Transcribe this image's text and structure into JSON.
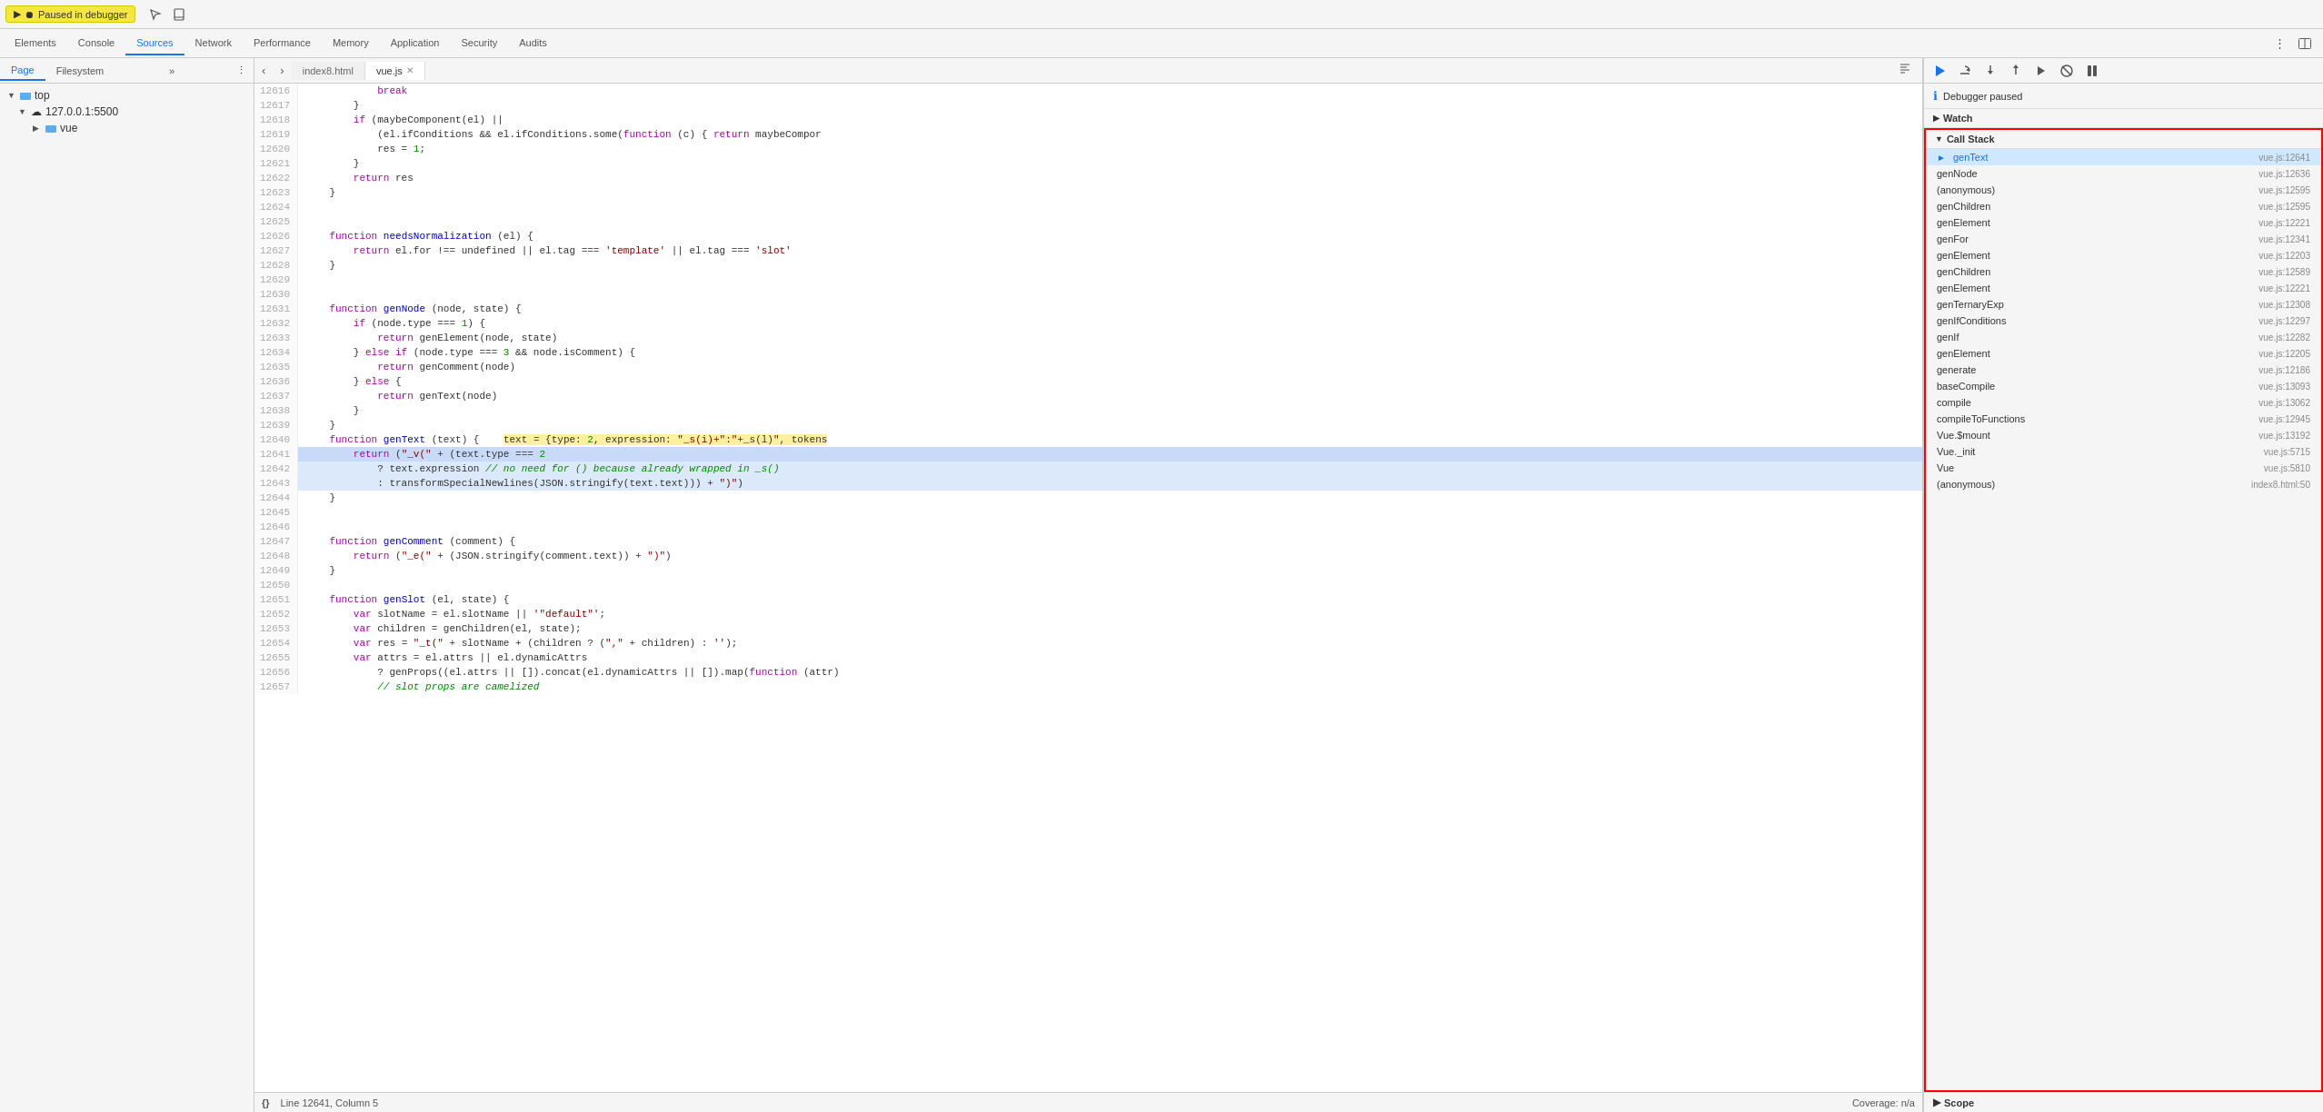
{
  "topbar": {
    "paused_label": "Paused in debugger",
    "icons": [
      "resume",
      "step-over",
      "step-into",
      "step-out",
      "deactivate"
    ]
  },
  "tabs": {
    "items": [
      {
        "label": "Elements",
        "active": false
      },
      {
        "label": "Console",
        "active": false
      },
      {
        "label": "Sources",
        "active": true
      },
      {
        "label": "Network",
        "active": false
      },
      {
        "label": "Performance",
        "active": false
      },
      {
        "label": "Memory",
        "active": false
      },
      {
        "label": "Application",
        "active": false
      },
      {
        "label": "Security",
        "active": false
      },
      {
        "label": "Audits",
        "active": false
      }
    ]
  },
  "file_panel": {
    "tabs": [
      "Page",
      "Filesystem"
    ],
    "tree": {
      "top_label": "top",
      "server_label": "127.0.0.1:5500",
      "vue_label": "vue"
    }
  },
  "editor": {
    "tabs": [
      {
        "name": "index8.html",
        "active": false
      },
      {
        "name": "vue.js",
        "active": true,
        "closeable": true
      }
    ],
    "lines": [
      {
        "num": "12616",
        "content": "            break",
        "highlight": false
      },
      {
        "num": "12617",
        "content": "        }",
        "highlight": false
      },
      {
        "num": "12618",
        "content": "        if (maybeComponent(el) ||",
        "highlight": false
      },
      {
        "num": "12619",
        "content": "            (el.ifConditions && el.ifConditions.some(function (c) { return maybeCompor",
        "highlight": false
      },
      {
        "num": "12620",
        "content": "            res = 1;",
        "highlight": false
      },
      {
        "num": "12621",
        "content": "        }",
        "highlight": false
      },
      {
        "num": "12622",
        "content": "        return res",
        "highlight": false
      },
      {
        "num": "12623",
        "content": "    }",
        "highlight": false
      },
      {
        "num": "12624",
        "content": "",
        "highlight": false
      },
      {
        "num": "12625",
        "content": "",
        "highlight": false
      },
      {
        "num": "12626",
        "content": "    function needsNormalization (el) {",
        "highlight": false
      },
      {
        "num": "12627",
        "content": "        return el.for !== undefined || el.tag === 'template' || el.tag === 'slot'",
        "highlight": false
      },
      {
        "num": "12628",
        "content": "    }",
        "highlight": false
      },
      {
        "num": "12629",
        "content": "",
        "highlight": false
      },
      {
        "num": "12630",
        "content": "",
        "highlight": false
      },
      {
        "num": "12631",
        "content": "    function genNode (node, state) {",
        "highlight": false
      },
      {
        "num": "12632",
        "content": "        if (node.type === 1) {",
        "highlight": false
      },
      {
        "num": "12633",
        "content": "            return genElement(node, state)",
        "highlight": false
      },
      {
        "num": "12634",
        "content": "        } else if (node.type === 3 && node.isComment) {",
        "highlight": false
      },
      {
        "num": "12635",
        "content": "            return genComment(node)",
        "highlight": false
      },
      {
        "num": "12636",
        "content": "        } else {",
        "highlight": false
      },
      {
        "num": "12637",
        "content": "            return genText(node)",
        "highlight": false
      },
      {
        "num": "12638",
        "content": "        }",
        "highlight": false
      },
      {
        "num": "12639",
        "content": "    }",
        "highlight": false
      },
      {
        "num": "12640",
        "content": "    function genText (text) {    text = {type: 2, expression: \"_s(i)+\":\"+_s(l)\", tokens",
        "highlight": false,
        "has_hover": true
      },
      {
        "num": "12641",
        "content": "        return (\"_v(\" + (text.type === 2",
        "highlight": true,
        "active": true
      },
      {
        "num": "12642",
        "content": "            ? text.expression // no need for () because already wrapped in _s()",
        "highlight": true,
        "comment": true
      },
      {
        "num": "12643",
        "content": "            : transformSpecialNewlines(JSON.stringify(text.text))) + \")\")",
        "highlight": true
      },
      {
        "num": "12644",
        "content": "    }",
        "highlight": false
      },
      {
        "num": "12645",
        "content": "",
        "highlight": false
      },
      {
        "num": "12646",
        "content": "",
        "highlight": false
      },
      {
        "num": "12647",
        "content": "    function genComment (comment) {",
        "highlight": false
      },
      {
        "num": "12648",
        "content": "        return (\"_e(\" + (JSON.stringify(comment.text)) + \")\")",
        "highlight": false
      },
      {
        "num": "12649",
        "content": "    }",
        "highlight": false
      },
      {
        "num": "12650",
        "content": "",
        "highlight": false
      },
      {
        "num": "12651",
        "content": "    function genSlot (el, state) {",
        "highlight": false
      },
      {
        "num": "12652",
        "content": "        var slotName = el.slotName || '\"default\"';",
        "highlight": false
      },
      {
        "num": "12653",
        "content": "        var children = genChildren(el, state);",
        "highlight": false
      },
      {
        "num": "12654",
        "content": "        var res = \"_t(\" + slotName + (children ? (\",\" + children) : '');",
        "highlight": false
      },
      {
        "num": "12655",
        "content": "        var attrs = el.attrs || el.dynamicAttrs",
        "highlight": false
      },
      {
        "num": "12656",
        "content": "            ? genProps((el.attrs || []).concat(el.dynamicAttrs || []).map(function (attr)",
        "highlight": false
      },
      {
        "num": "12657",
        "content": "            // slot props are camelized",
        "highlight": false,
        "comment": true
      }
    ]
  },
  "status_bar": {
    "braces": "{}",
    "position": "Line 12641, Column 5",
    "coverage": "Coverage: n/a"
  },
  "debug_panel": {
    "toolbar_buttons": [
      "resume",
      "step-over",
      "step-into",
      "step-out",
      "step-out-of-async",
      "deactivate-breakpoints",
      "pause"
    ],
    "paused_text": "Debugger paused",
    "watch_label": "Watch",
    "call_stack_label": "Call Stack",
    "scope_label": "Scope",
    "call_stack": [
      {
        "fn": "genText",
        "location": "vue.js:12641",
        "active": true
      },
      {
        "fn": "genNode",
        "location": "vue.js:12636"
      },
      {
        "fn": "(anonymous)",
        "location": "vue.js:12595"
      },
      {
        "fn": "genChildren",
        "location": "vue.js:12595"
      },
      {
        "fn": "genElement",
        "location": "vue.js:12221"
      },
      {
        "fn": "genFor",
        "location": "vue.js:12341"
      },
      {
        "fn": "genElement",
        "location": "vue.js:12203"
      },
      {
        "fn": "genChildren",
        "location": "vue.js:12589"
      },
      {
        "fn": "genElement",
        "location": "vue.js:12221"
      },
      {
        "fn": "genTernaryExp",
        "location": "vue.js:12308"
      },
      {
        "fn": "genIfConditions",
        "location": "vue.js:12297"
      },
      {
        "fn": "genIf",
        "location": "vue.js:12282"
      },
      {
        "fn": "genElement",
        "location": "vue.js:12205"
      },
      {
        "fn": "generate",
        "location": "vue.js:12186"
      },
      {
        "fn": "baseCompile",
        "location": "vue.js:13093"
      },
      {
        "fn": "compile",
        "location": "vue.js:13062"
      },
      {
        "fn": "compileToFunctions",
        "location": "vue.js:12945"
      },
      {
        "fn": "Vue.$mount",
        "location": "vue.js:13192"
      },
      {
        "fn": "Vue._init",
        "location": "vue.js:5715"
      },
      {
        "fn": "Vue",
        "location": "vue.js:5810"
      },
      {
        "fn": "(anonymous)",
        "location": "index8.html:50"
      }
    ]
  }
}
